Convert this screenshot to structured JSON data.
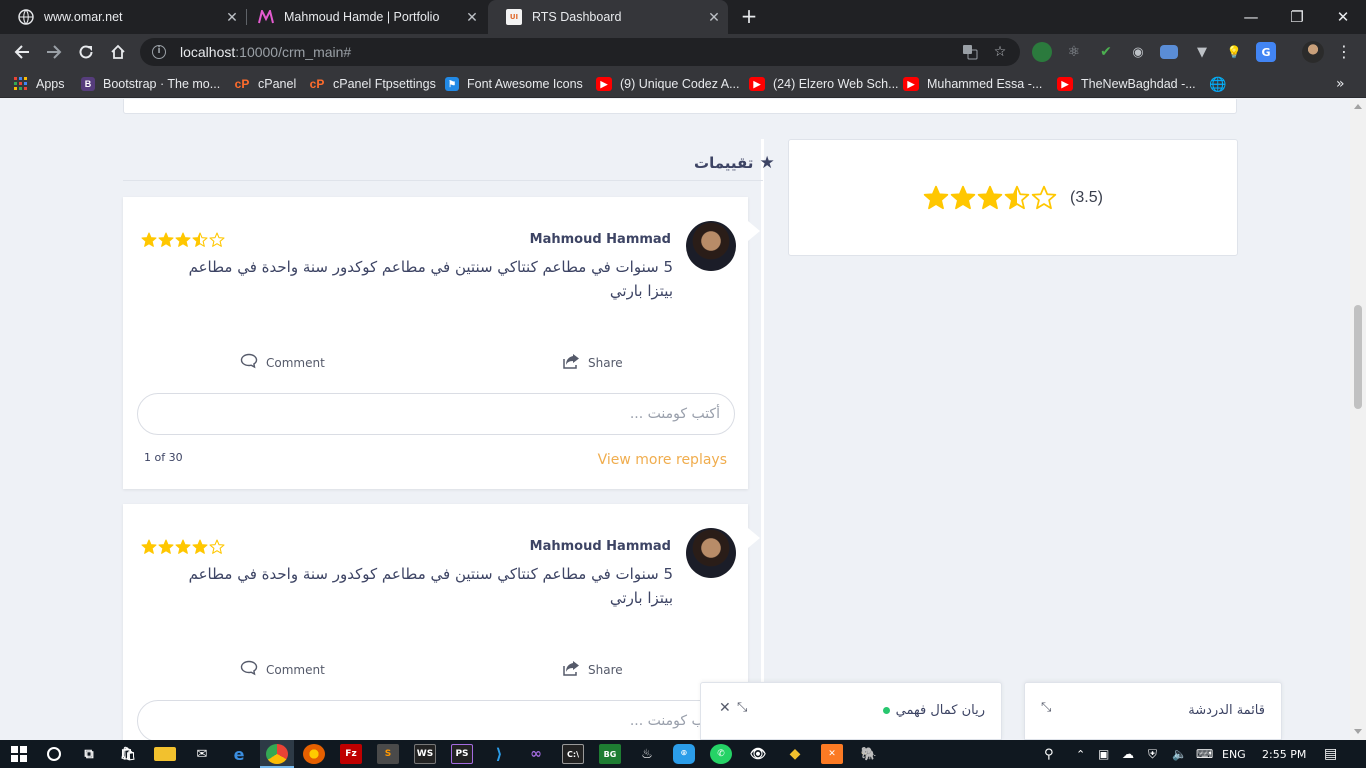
{
  "browser": {
    "tabs": [
      {
        "title": "www.omar.net",
        "icon": "globe-icon"
      },
      {
        "title": "Mahmoud Hamde | Portfolio",
        "icon": "m-logo-icon"
      },
      {
        "title": "RTS Dashboard",
        "icon": "ui-logo-icon",
        "active": true
      }
    ],
    "url_host": "localhost",
    "url_path": ":10000/crm_main#",
    "bookmarks": [
      {
        "label": "Apps",
        "icon": "apps-grid-icon"
      },
      {
        "label": "Bootstrap · The mo...",
        "icon": "bootstrap-icon",
        "color": "#563d7c"
      },
      {
        "label": "cPanel",
        "icon": "cpanel-icon",
        "color": "#ff6c2c"
      },
      {
        "label": "cPanel Ftpsettings",
        "icon": "cpanel-icon",
        "color": "#ff6c2c"
      },
      {
        "label": "Font Awesome Icons",
        "icon": "flag-icon",
        "color": "#228ae6"
      },
      {
        "label": "(9) Unique Codez A...",
        "icon": "youtube-icon",
        "color": "#ff0000"
      },
      {
        "label": "(24) Elzero Web Sch...",
        "icon": "youtube-icon",
        "color": "#ff0000"
      },
      {
        "label": "Muhammed Essa -...",
        "icon": "youtube-icon",
        "color": "#ff0000"
      },
      {
        "label": "TheNewBaghdad -...",
        "icon": "youtube-icon",
        "color": "#ff0000"
      }
    ]
  },
  "page": {
    "summary": {
      "rating": 3.5,
      "score_label": "(3.5)"
    },
    "section_title": "تقييمات",
    "reviews": [
      {
        "author": "Mahmoud Hammad",
        "rating": 3.5,
        "text": "5 سنوات في مطاعم كنتاكي سنتين في مطاعم كوكدور سنة واحدة في مطاعم بيتزا بارتي",
        "comment_label": "Comment",
        "share_label": "Share",
        "comment_placeholder": "أكتب كومنت ...",
        "pager": "1 of 30",
        "more_label": "View more replays"
      },
      {
        "author": "Mahmoud Hammad",
        "rating": 4,
        "text": "5 سنوات في مطاعم كنتاكي سنتين في مطاعم كوكدور سنة واحدة في مطاعم بيتزا بارتي",
        "comment_label": "Comment",
        "share_label": "Share",
        "comment_placeholder": "أكتب كومنت ..."
      }
    ],
    "chat_windows": [
      {
        "title": "ريان كمال فهمي",
        "online": true
      },
      {
        "title": "قائمة الدردشة"
      }
    ]
  },
  "taskbar": {
    "language": "ENG",
    "time": "2:55 PM"
  },
  "colors": {
    "star": "#ffc700",
    "accent_orange": "#f0ad4e",
    "text_dark": "#3d4464",
    "online": "#28c76f"
  }
}
